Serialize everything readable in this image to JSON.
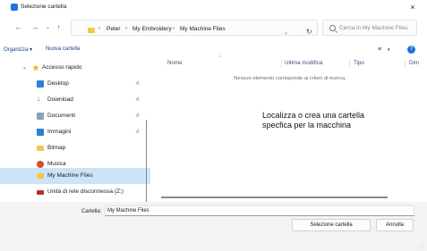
{
  "window": {
    "title": "Selezione cartella",
    "close_glyph": "×"
  },
  "nav": {
    "back_glyph": "←",
    "forward_glyph": "→",
    "recent_glyph": "⌄",
    "up_glyph": "↑"
  },
  "address": {
    "sep": "›",
    "crumbs": [
      "Peter",
      "My Embroidery",
      "My Machine Files"
    ],
    "dropdown_glyph": "⌄",
    "refresh_glyph": "↻"
  },
  "search": {
    "placeholder": "Cerca in My Machine Files"
  },
  "commandbar": {
    "organize_label": "Organizza ▾",
    "new_folder_label": "Nuova cartella",
    "view_glyph": "≡",
    "view_caret": "▾",
    "help_glyph": "?"
  },
  "sidebar": {
    "quick_access": {
      "label": "Accesso rapido",
      "chevron": "⌄"
    },
    "pin_glyph": "⊀",
    "items": [
      {
        "label": "Desktop",
        "icon": "desktop-icon",
        "color": "#2f7fd3"
      },
      {
        "label": "Download",
        "icon": "download-icon",
        "color": "#2a8c3a"
      },
      {
        "label": "Documenti",
        "icon": "documents-icon",
        "color": "#8aa0b8"
      },
      {
        "label": "Immagini",
        "icon": "pictures-icon",
        "color": "#2f7fd3"
      },
      {
        "label": "Bitmap",
        "icon": "folder-icon",
        "color": "#f3c74f"
      },
      {
        "label": "Musica",
        "icon": "music-icon",
        "color": "#d4502a"
      },
      {
        "label": "My Machine Files",
        "icon": "folder-icon",
        "color": "#f3c74f"
      },
      {
        "label": "Unità di rete disconnessa (Z:)",
        "icon": "network-drive-icon",
        "color": "#b03030"
      }
    ]
  },
  "filelist": {
    "columns": [
      "Nome",
      "Ultima modifica",
      "Tipo",
      "Dim"
    ],
    "sort_caret": "^",
    "empty_message": "Nessun elemento corrisponde ai criteri di ricerca."
  },
  "annotation": "Localizza o crea una cartella specfica per la macchina",
  "bottom": {
    "folder_label": "Cartella:",
    "folder_value": "My Machine Files",
    "select_button": "Selezione cartella",
    "cancel_button": "Annulla"
  }
}
